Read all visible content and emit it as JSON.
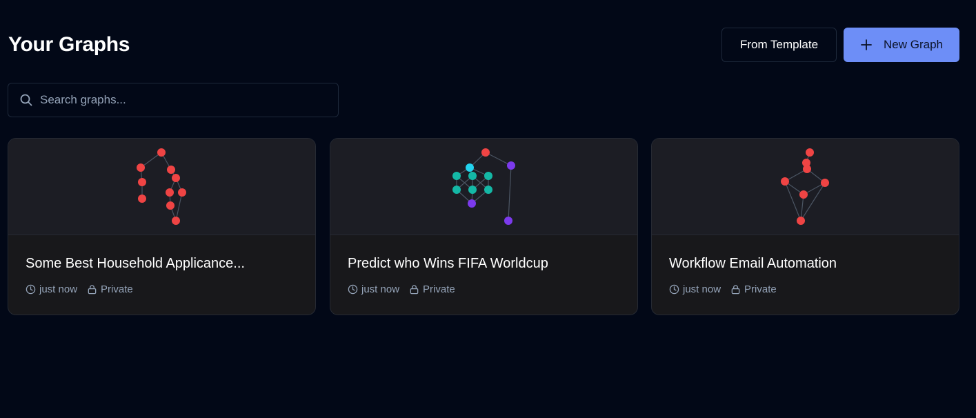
{
  "header": {
    "title": "Your Graphs",
    "from_template_label": "From Template",
    "new_graph_label": "New Graph"
  },
  "search": {
    "placeholder": "Search graphs...",
    "value": ""
  },
  "colors": {
    "background": "#020817",
    "accent": "#6d8ef7",
    "node_red": "#ef4444",
    "node_teal": "#14b8a6",
    "node_cyan": "#22d3ee",
    "node_purple": "#7c3aed"
  },
  "graphs": [
    {
      "title": "Some Best Household Applicance...",
      "updated": "just now",
      "visibility": "Private"
    },
    {
      "title": "Predict who Wins FIFA Worldcup",
      "updated": "just now",
      "visibility": "Private"
    },
    {
      "title": "Workflow Email Automation",
      "updated": "just now",
      "visibility": "Private"
    }
  ]
}
